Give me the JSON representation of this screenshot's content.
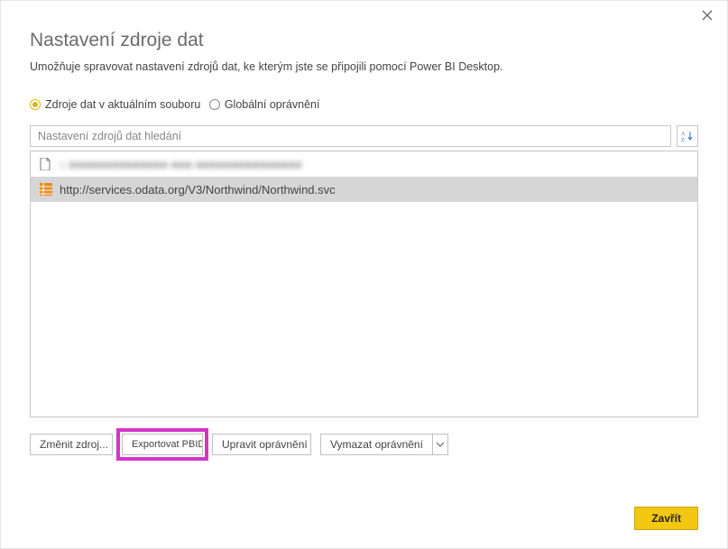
{
  "dialog": {
    "title": "Nastavení zdroje dat",
    "description": "Umožňuje spravovat nastavení zdrojů dat, ke kterým jste se připojili pomocí Power BI Desktop."
  },
  "radios": {
    "current": "Zdroje dat v aktuálním souboru",
    "global": "Globální oprávnění"
  },
  "search": {
    "placeholder": "Nastavení zdrojů dat hledání"
  },
  "items": [
    {
      "label": "c ■■■■■■■■■■■■■■ ■■■ ■■■■■■■■■■■■■■■",
      "type": "file",
      "selected": false,
      "blurred": true
    },
    {
      "label": "http://services.odata.org/V3/Northwind/Northwind.svc",
      "type": "odata",
      "selected": true,
      "blurred": false
    }
  ],
  "buttons": {
    "change": "Změnit zdroj...",
    "export": "Exportovat PBIDS",
    "edit": "Upravit oprávnění ...",
    "clear": "Vymazat oprávnění",
    "close": "Zavřít"
  }
}
